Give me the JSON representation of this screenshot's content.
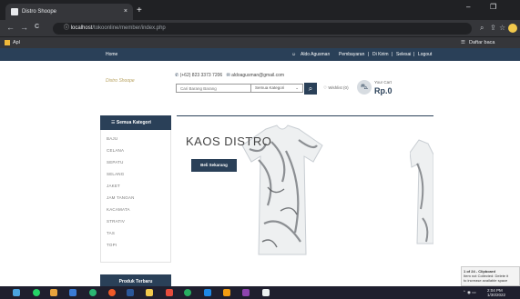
{
  "browser": {
    "tab_title": "Distro Shoope",
    "tab_close": "×",
    "new_tab": "+",
    "window_minimize": "–",
    "window_restore": "❐",
    "nav_back": "←",
    "nav_forward": "→",
    "nav_reload": "C",
    "secure_icon": "ⓘ",
    "url_host": "localhost",
    "url_path": "/tokoonline/member/index.php",
    "bookmark": "Apl",
    "reading_list": "Daftar baca"
  },
  "site": {
    "topnav": {
      "home": "Home",
      "user": "Aldo Agusman",
      "links": [
        "Pembayaran",
        "Di Kirim",
        "Selesai",
        "Logout"
      ],
      "separator": "|"
    },
    "logo_text": "Distro Shoope",
    "phone": "(+62) 823 3373 7206",
    "email": "aldoagusman@gmail.com",
    "search_placeholder": "Cari Barang Barang",
    "category_select": "Semua Kategori",
    "wishlist": "Wishlist (0)",
    "cart_label": "Your Cart",
    "cart_total": "Rp.0",
    "categories_header": "Semua Kategori",
    "categories": [
      "BAJU",
      "CELANA",
      "SEPATU",
      "SELANG",
      "JAKET",
      "JAM TANGAN",
      "KACAMATA",
      "STRATIV",
      "TAS",
      "TOPI"
    ],
    "banner_title": "KAOS DISTRO",
    "banner_button": "Beli Sekarang",
    "popular_header": "Produk Terbaru"
  },
  "clipboard_toast": {
    "title": "1 of 24 - Clipboard",
    "line1": "Item not Collected: Delete it",
    "line2": "to increase available space"
  },
  "taskbar": {
    "time": "2:04 PM",
    "date": "1/30/2022"
  },
  "colors": {
    "brand_navy": "#2a4058",
    "chrome_dark": "#202124",
    "chrome_mid": "#35363a"
  }
}
